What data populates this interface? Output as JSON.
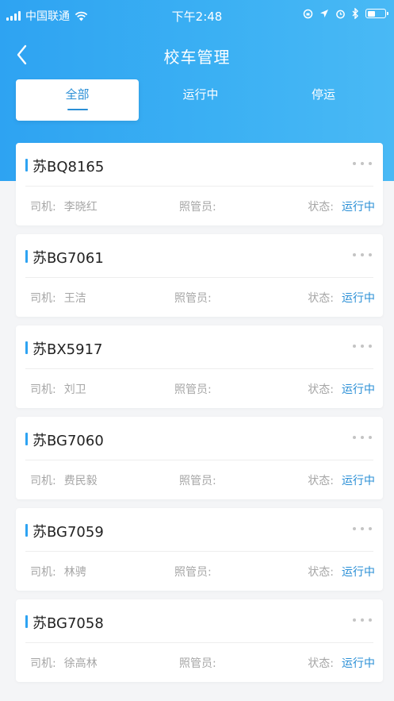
{
  "status_bar": {
    "carrier": "中国联通",
    "time": "下午2:48"
  },
  "nav": {
    "title": "校车管理"
  },
  "tabs": [
    {
      "label": "全部",
      "active": true
    },
    {
      "label": "运行中",
      "active": false
    },
    {
      "label": "停运",
      "active": false
    }
  ],
  "labels": {
    "driver": "司机:",
    "attendant": "照管员:",
    "status": "状态:"
  },
  "buses": [
    {
      "plate": "苏BQ8165",
      "driver": "李晓红",
      "status": "运行中"
    },
    {
      "plate": "苏BG7061",
      "driver": "王洁",
      "status": "运行中"
    },
    {
      "plate": "苏BX5917",
      "driver": "刘卫",
      "status": "运行中"
    },
    {
      "plate": "苏BG7060",
      "driver": "费民毅",
      "status": "运行中"
    },
    {
      "plate": "苏BG7059",
      "driver": "林骋",
      "status": "运行中"
    },
    {
      "plate": "苏BG7058",
      "driver": "徐高林",
      "status": "运行中"
    }
  ],
  "colors": {
    "accent": "#2ea3f2",
    "status_text": "#2a8fd6"
  }
}
